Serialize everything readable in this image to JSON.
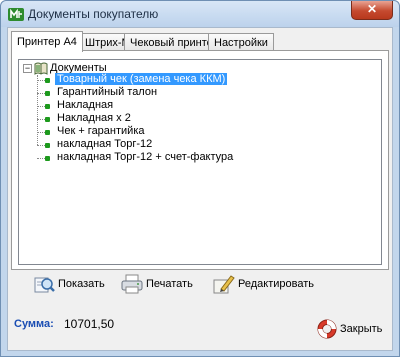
{
  "window": {
    "title": "Документы покупателю",
    "close_glyph": "✕"
  },
  "tabs": [
    {
      "label": "Принтер А4",
      "active": true
    },
    {
      "label": "Штрих-М",
      "active": false
    },
    {
      "label": "Чековый принтер",
      "active": false
    },
    {
      "label": "Настройки",
      "active": false
    }
  ],
  "tree": {
    "root_label": "Документы",
    "expander_glyph": "−",
    "items": [
      {
        "label": "Товарный чек (замена чека ККМ)",
        "selected": true
      },
      {
        "label": "Гарантийный талон",
        "selected": false
      },
      {
        "label": "Накладная",
        "selected": false
      },
      {
        "label": "Накладная х 2",
        "selected": false
      },
      {
        "label": "Чек + гарантийка",
        "selected": false
      },
      {
        "label": "накладная Торг-12",
        "selected": false
      },
      {
        "label": "накладная Торг-12 + счет-фактура",
        "selected": false
      }
    ]
  },
  "actions": {
    "show_label": "Показать",
    "print_label": "Печатать",
    "edit_label": "Редактировать"
  },
  "summary": {
    "label": "Сумма:",
    "value": "10701,50"
  },
  "close_button": {
    "label": "Закрыть"
  },
  "icons": {
    "app": "app-logo-icon",
    "show": "preview-icon",
    "print": "printer-icon",
    "edit": "edit-pen-icon",
    "close": "lifebuoy-icon",
    "root": "book-icon"
  },
  "colors": {
    "selection": "#3399ff",
    "sum_label": "#1a4db3",
    "tree_bullet": "#1d9a1d",
    "close_button": "#c54a2f"
  }
}
